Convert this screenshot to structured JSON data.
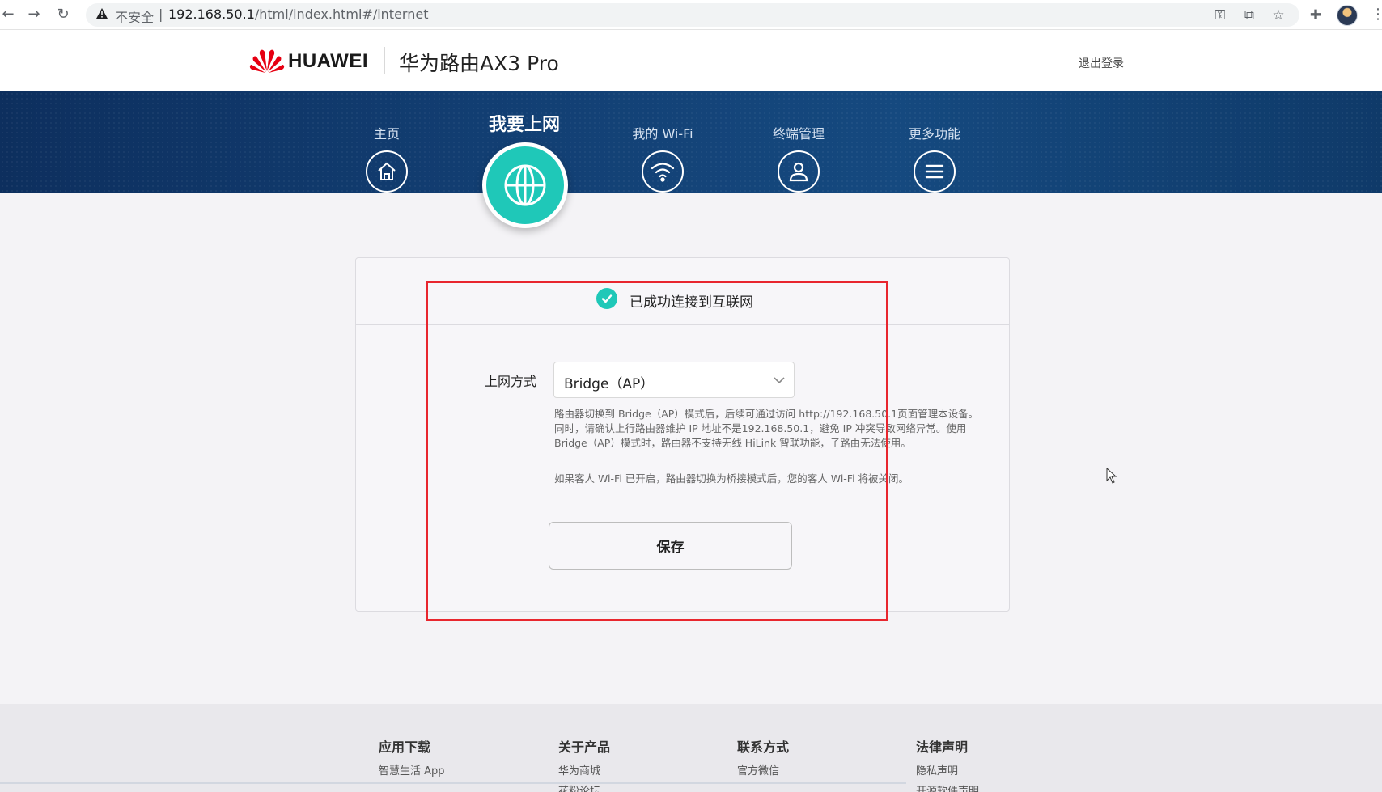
{
  "browser": {
    "security_label": "不安全",
    "url_host": "192.168.50.1",
    "url_path": "/html/index.html#/internet"
  },
  "header": {
    "brand": "HUAWEI",
    "product": "华为路由AX3 Pro",
    "logout": "退出登录"
  },
  "nav": {
    "items": [
      {
        "label": "主页",
        "icon": "home-icon"
      },
      {
        "label": "我要上网",
        "icon": "globe-icon",
        "active": true
      },
      {
        "label": "我的 Wi-Fi",
        "icon": "wifi-icon"
      },
      {
        "label": "终端管理",
        "icon": "user-icon"
      },
      {
        "label": "更多功能",
        "icon": "menu-icon"
      }
    ]
  },
  "card": {
    "status": "已成功连接到互联网",
    "field_label": "上网方式",
    "select_value": "Bridge（AP）",
    "help_1": "路由器切换到 Bridge（AP）模式后，后续可通过访问 http://192.168.50.1页面管理本设备。同时，请确认上行路由器维护 IP 地址不是192.168.50.1，避免 IP 冲突导致网络异常。使用 Bridge（AP）模式时，路由器不支持无线 HiLink 智联功能，子路由无法使用。",
    "help_2": "如果客人 Wi-Fi 已开启，路由器切换为桥接模式后，您的客人 Wi-Fi 将被关闭。",
    "save": "保存"
  },
  "footer": {
    "columns": [
      {
        "title": "应用下载",
        "links": [
          "智慧生活 App"
        ]
      },
      {
        "title": "关于产品",
        "links": [
          "华为商城",
          "花粉论坛"
        ]
      },
      {
        "title": "联系方式",
        "links": [
          "官方微信"
        ]
      },
      {
        "title": "法律声明",
        "links": [
          "隐私声明",
          "开源软件声明"
        ]
      }
    ]
  },
  "colors": {
    "accent": "#1fc8b8",
    "nav_band": "#123e72",
    "highlight": "#e8262e"
  }
}
